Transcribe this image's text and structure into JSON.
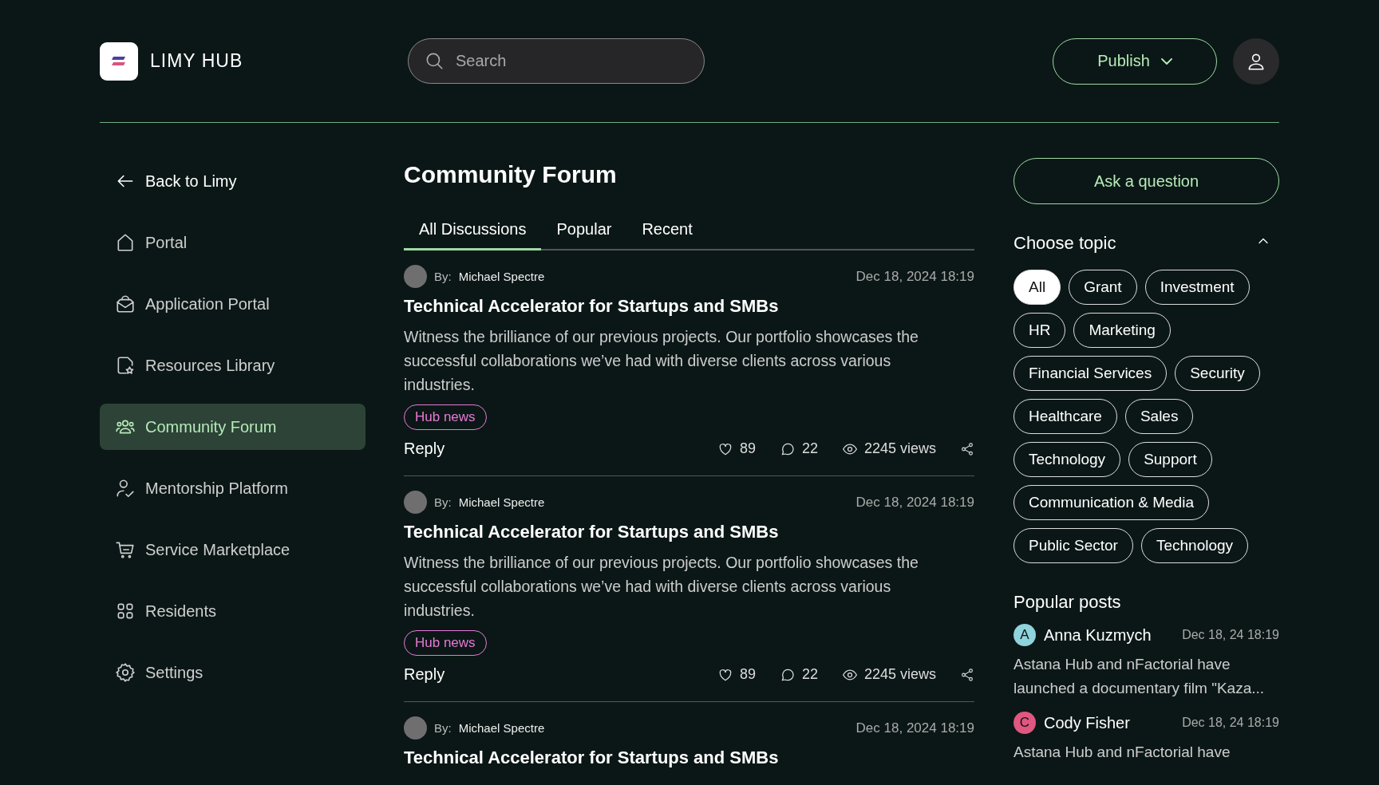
{
  "header": {
    "brand": "LIMY HUB",
    "search": {
      "placeholder": "Search"
    },
    "publish": "Publish"
  },
  "sidebar": {
    "back": "Back to Limy",
    "items": [
      {
        "label": "Portal",
        "kind": "home",
        "selected": false
      },
      {
        "label": "Application Portal",
        "kind": "bag",
        "selected": false
      },
      {
        "label": "Resources Library",
        "kind": "file",
        "selected": false
      },
      {
        "label": "Community Forum",
        "kind": "users",
        "selected": true
      },
      {
        "label": "Mentorship Platform",
        "kind": "person",
        "selected": false
      },
      {
        "label": "Service Marketplace",
        "kind": "cart",
        "selected": false
      },
      {
        "label": "Residents",
        "kind": "grid",
        "selected": false
      },
      {
        "label": "Settings",
        "kind": "gear",
        "selected": false
      }
    ]
  },
  "main": {
    "title": "Community Forum",
    "tabs": [
      {
        "label": "All Discussions",
        "selected": true
      },
      {
        "label": "Popular",
        "selected": false
      },
      {
        "label": "Recent",
        "selected": false
      }
    ],
    "posts": [
      {
        "by": "By:",
        "author": "Michael Spectre",
        "date": "Dec 18, 2024 18:19",
        "title": "Technical Accelerator for Startups and SMBs",
        "body": "Witness the brilliance of our previous projects. Our portfolio showcases the successful collaborations we’ve had with diverse clients across various industries.",
        "tag": "Hub news",
        "reply": "Reply",
        "likes": "89",
        "comments": "22",
        "views": "2245 views"
      },
      {
        "by": "By:",
        "author": "Michael Spectre",
        "date": "Dec 18, 2024 18:19",
        "title": "Technical Accelerator for Startups and SMBs",
        "body": "Witness the brilliance of our previous projects. Our portfolio showcases the successful collaborations we’ve had with diverse clients across various industries.",
        "tag": "Hub news",
        "reply": "Reply",
        "likes": "89",
        "comments": "22",
        "views": "2245 views"
      },
      {
        "by": "By:",
        "author": "Michael Spectre",
        "date": "Dec 18, 2024 18:19",
        "title": "Technical Accelerator for Startups and SMBs"
      }
    ]
  },
  "aside": {
    "ask": "Ask a question",
    "topics": {
      "title": "Choose topic",
      "expanded": true,
      "items": [
        {
          "label": "All",
          "selected": true
        },
        {
          "label": "Grant",
          "selected": false
        },
        {
          "label": "Investment",
          "selected": false
        },
        {
          "label": "HR",
          "selected": false
        },
        {
          "label": "Marketing",
          "selected": false
        },
        {
          "label": "Financial Services",
          "selected": false
        },
        {
          "label": "Security",
          "selected": false
        },
        {
          "label": "Healthcare",
          "selected": false
        },
        {
          "label": "Sales",
          "selected": false
        },
        {
          "label": "Technology",
          "selected": false
        },
        {
          "label": "Support",
          "selected": false
        },
        {
          "label": "Communication & Media",
          "selected": false
        },
        {
          "label": "Public Sector",
          "selected": false
        },
        {
          "label": "Technology",
          "selected": false
        }
      ]
    },
    "popular": {
      "title": "Popular posts",
      "items": [
        {
          "initial": "A",
          "name": "Anna  Kuzmych",
          "date": "Dec 18, 24 18:19",
          "text": "Astana Hub and nFactorial have launched a documentary film \"Kaza...",
          "color": "#8fd3dc"
        },
        {
          "initial": "C",
          "name": "Cody Fisher",
          "date": "Dec 18, 24 18:19",
          "text": "Astana Hub and nFactorial have",
          "color": "#e0577f"
        }
      ]
    }
  }
}
